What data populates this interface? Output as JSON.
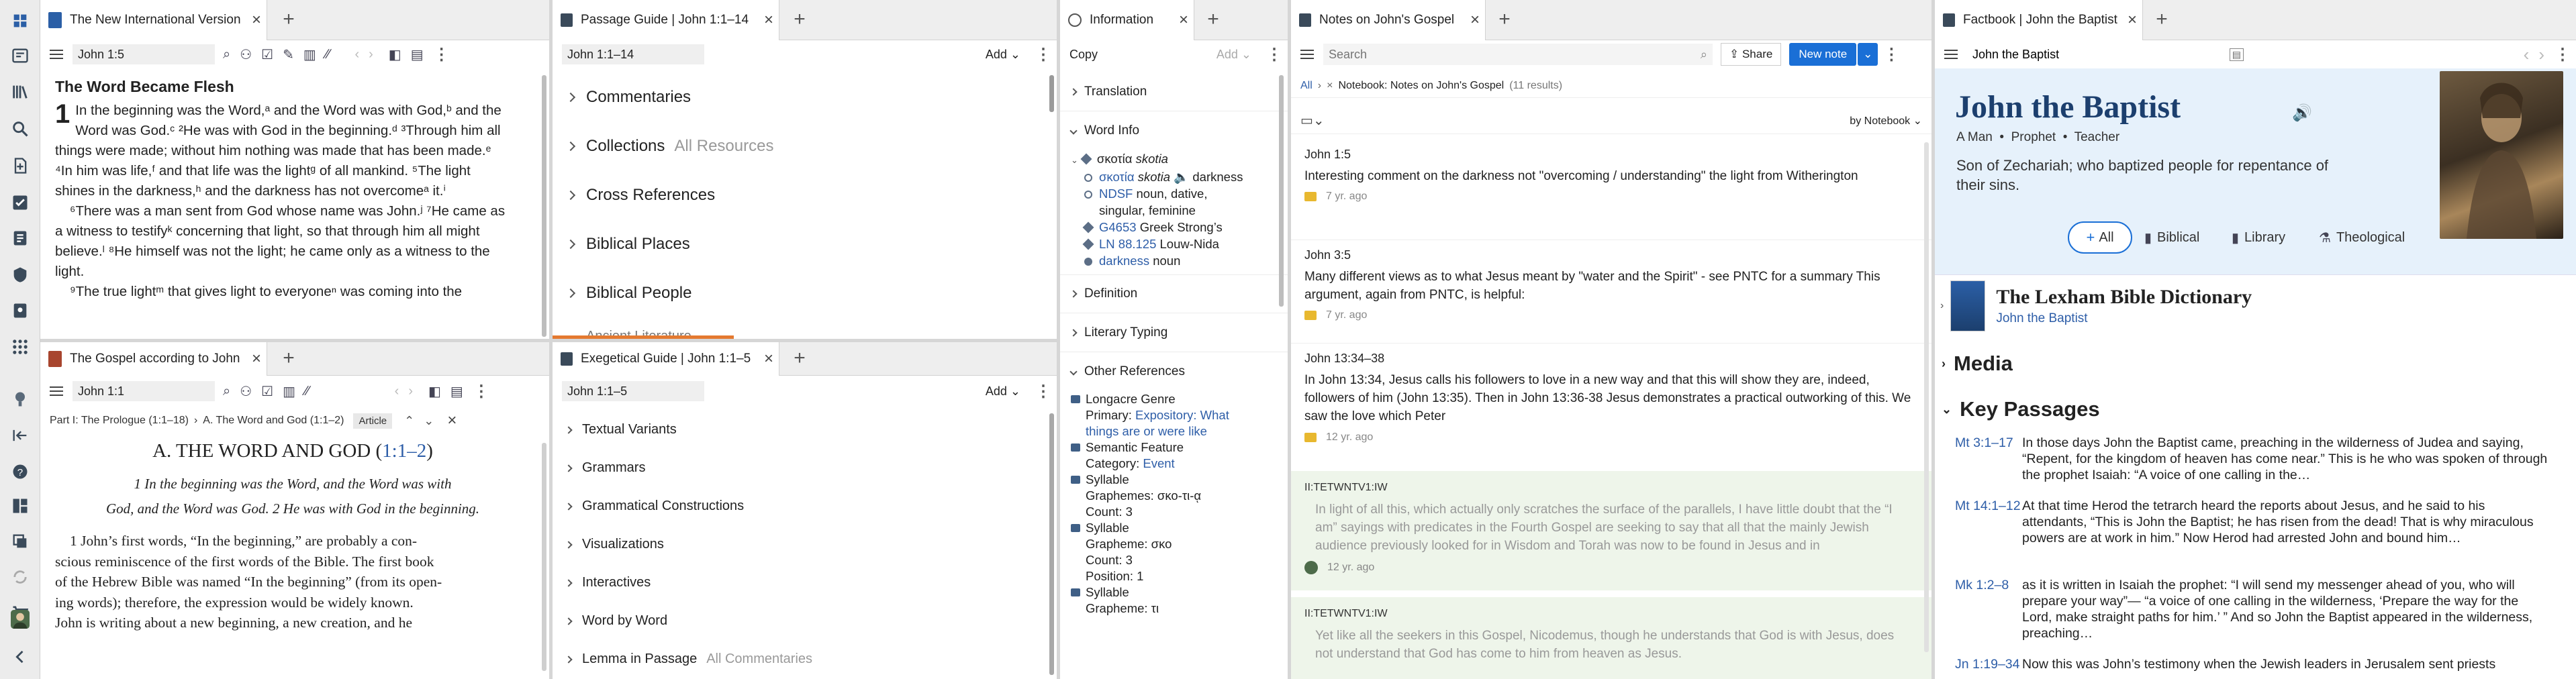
{
  "rail": {
    "icons": [
      "home-icon",
      "dashboard-icon",
      "library-icon",
      "search-icon",
      "documents-icon",
      "reading-plan-icon",
      "notes-icon",
      "guides-icon",
      "factbook-icon",
      "tools-icon",
      "more-apps-icon",
      "help-icon",
      "layouts-icon",
      "sync-icon",
      "history-icon",
      "store-icon",
      "avatar",
      "collapse-icon"
    ]
  },
  "niv": {
    "tab": "The New International Version",
    "ref": "John 1:5",
    "heading": "The Word Became Flesh",
    "chapter": "1",
    "lines": [
      "In the beginning was the Word,ᵃ and the Word was with God,ᵇ and the",
      "Word was God.ᶜ ²He was with God in the beginning.ᵈ ³Through him all",
      "things were made; without him nothing was made that has been made.ᵉ",
      "⁴In him was life,ᶠ and that life was the lightᵍ of all mankind. ⁵The light",
      "shines in the darkness,ʰ and the darkness has not overcomeᵃ it.ⁱ",
      "⁶There was a man sent from God whose name was John.ʲ ⁷He came as",
      "a witness to testifyᵏ concerning that light, so that through him all might",
      "believe.ˡ ⁸He himself was not the light; he came only as a witness to the",
      "light.",
      "⁹The true lightᵐ that gives light to everyoneⁿ was coming into the"
    ]
  },
  "gospel": {
    "tab": "The Gospel according to John",
    "ref": "John 1:1",
    "crumb1": "Part I: The Prologue (1:1–18)",
    "crumb_sep": "›",
    "crumb2": "A. The Word and God (1:1–2)",
    "article": "Article",
    "section_title": "A. THE WORD AND GOD (",
    "section_ref": "1:1–2",
    "section_close": ")",
    "quote1": "1 In the beginning was the Word, and the Word was with",
    "quote2": "God, and the Word was God. 2 He was with God in the beginning.",
    "lines": [
      "1 John’s first words, “In the beginning,” are probably a con-",
      "scious reminiscence of the first words of the Bible. The first book",
      "of the Hebrew Bible was named “In the beginning” (from its open-",
      "ing words); therefore, the expression would be widely known.",
      "John is writing about a new beginning, a new creation, and he"
    ]
  },
  "passage": {
    "tab": "Passage Guide | John 1:1–14",
    "ref": "John 1:1–14",
    "add": "Add",
    "rows": [
      {
        "label": "Commentaries",
        "sub": ""
      },
      {
        "label": "Collections",
        "sub": "All Resources"
      },
      {
        "label": "Cross References",
        "sub": ""
      },
      {
        "label": "Biblical Places",
        "sub": ""
      },
      {
        "label": "Biblical People",
        "sub": ""
      },
      {
        "label": "Ancient Literature",
        "sub": ""
      }
    ]
  },
  "exeg": {
    "tab": "Exegetical Guide | John 1:1–5",
    "ref": "John 1:1–5",
    "add": "Add",
    "rows": [
      {
        "label": "Textual Variants",
        "sub": ""
      },
      {
        "label": "Grammars",
        "sub": ""
      },
      {
        "label": "Grammatical Constructions",
        "sub": ""
      },
      {
        "label": "Visualizations",
        "sub": ""
      },
      {
        "label": "Interactives",
        "sub": ""
      },
      {
        "label": "Word by Word",
        "sub": ""
      },
      {
        "label": "Lemma in Passage",
        "sub": "All Commentaries"
      }
    ]
  },
  "info": {
    "tab": "Information",
    "copy": "Copy",
    "add": "Add",
    "translation": "Translation",
    "word_info": "Word Info",
    "lemma": "σκοτία",
    "lemma_tr": "skotia",
    "sense_greek": "σκοτία",
    "sense_tr": "skotia",
    "sense_gloss": "darkness",
    "ndsf": "NDSF",
    "ndsf_desc": "noun, dative,",
    "ndsf_desc2": "singular, feminine",
    "strong": "G4653",
    "strong_desc": "Greek Strong’s",
    "ln": "LN 88.125",
    "ln_desc": "Louw-Nida",
    "dark": "darkness",
    "dark_desc": "noun",
    "definition": "Definition",
    "literary": "Literary Typing",
    "other_refs": "Other References",
    "genre_t": "Longacre Genre",
    "genre_l": "Primary:",
    "genre_v": "Expository: What things are or were like",
    "sem_t": "Semantic Feature",
    "sem_l": "Category:",
    "sem_v": "Event",
    "syl1_t": "Syllable",
    "syl1_g": "Graphemes: σκο-τι-ᾳ",
    "syl1_c": "Count: 3",
    "syl2_t": "Syllable",
    "syl2_g": "Grapheme: σκο",
    "syl2_c": "Count: 3",
    "syl2_p": "Position: 1",
    "syl3_t": "Syllable",
    "syl3_g": "Grapheme: τι"
  },
  "notes": {
    "tab": "Notes on John's Gospel",
    "search_ph": "Search",
    "share": "Share",
    "new_note": "New note",
    "all": "All",
    "notebook": "Notebook: Notes on John's Gospel",
    "count": "(11 results)",
    "sort": "by Notebook",
    "items": [
      {
        "ref": "John 1:5",
        "body": "Interesting comment on the darkness not \"overcoming / understanding\" the light from Witherington",
        "age": "7 yr. ago"
      },
      {
        "ref": "John 3:5",
        "body": "Many different views as to what Jesus meant by \"water and the Spirit\" - see PNTC for a summary This argument, again from PNTC, is helpful:",
        "age": "7 yr. ago"
      },
      {
        "ref": "John 13:34–38",
        "body": "In John 13:34, Jesus calls his followers to love in a new way and that this will show they are, indeed, followers of him (John 13:35). Then in John 13:36-38 Jesus demonstrates a practical outworking of this. We saw the love which Peter",
        "age": "12 yr. ago"
      }
    ],
    "shared": [
      {
        "ref": "II:TETWNTV1:IW",
        "body": "In light of all this, which actually only scratches the surface of the parallels, I have little doubt that the “I am” sayings with predicates in the Fourth Gospel are seeking to say that all that the mainly Jewish audience previously looked for in Wisdom and Torah was now to be found in Jesus and in",
        "age": "12 yr. ago"
      },
      {
        "ref": "II:TETWNTV1:IW",
        "body": "Yet like all the seekers in this Gospel, Nicodemus, though he understands that God is with Jesus, does not understand that God has come to him from heaven as Jesus.",
        "age": ""
      }
    ]
  },
  "factbook": {
    "tab": "Factbook | John the Baptist",
    "query": "John the Baptist",
    "name": "John the Baptist",
    "kinds": "A Man  •  Prophet  •  Teacher",
    "desc": "Son of Zechariah; who baptized people for repentance of their sins.",
    "filters": [
      "All",
      "Biblical",
      "Library",
      "Theological"
    ],
    "dict_title": "The Lexham Bible Dictionary",
    "dict_sub": "John the Baptist",
    "media": "Media",
    "key_passages": "Key Passages",
    "passages": [
      {
        "ref": "Mt 3:1–17",
        "text": "In those days John the Baptist came, preaching in the wilderness of Judea and saying, “Repent, for the kingdom of heaven has come near.” This is he who was spoken of through the prophet Isaiah: “A voice of one calling in the…"
      },
      {
        "ref": "Mt 14:1–12",
        "text": "At that time Herod the tetrarch heard the reports about Jesus, and he said to his attendants, “This is John the Baptist; he has risen from the dead! That is why miraculous powers are at work in him.” Now Herod had arrested John and bound him…"
      },
      {
        "ref": "Mk 1:2–8",
        "text": "as it is written in Isaiah the prophet: “I will send my messenger ahead of you, who will prepare your way”— “a voice of one calling in the wilderness, ‘Prepare the way for the Lord, make straight paths for him.’ ” And so John the Baptist appeared in the wilderness, preaching…"
      },
      {
        "ref": "Jn 1:19–34",
        "text": "Now this was John’s testimony when the Jewish leaders in Jerusalem sent priests"
      }
    ]
  }
}
